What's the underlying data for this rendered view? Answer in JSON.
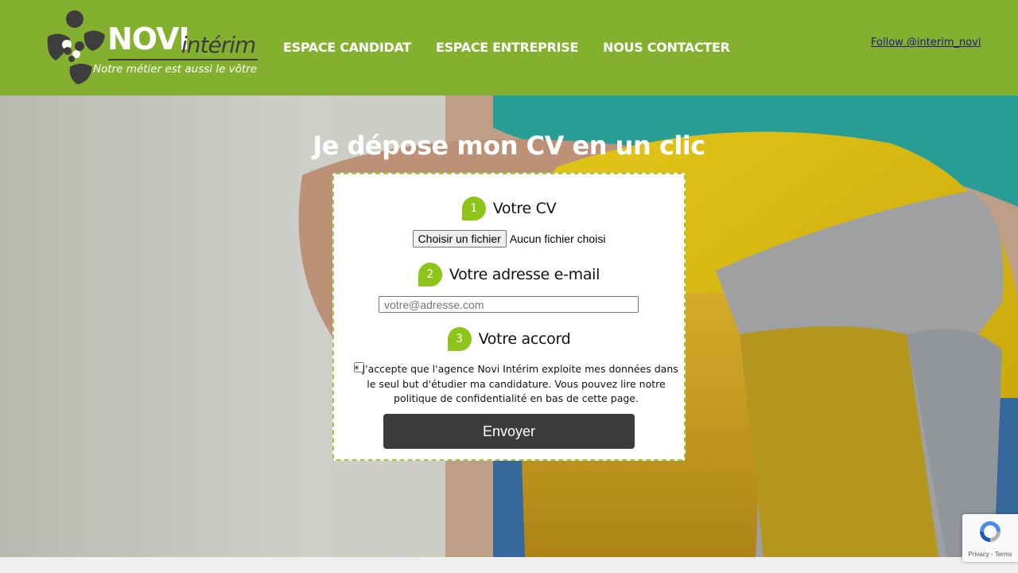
{
  "header": {
    "logo": {
      "brand": "NOVI",
      "brand_suffix": "intérim",
      "tagline": "Notre métier est aussi le vôtre"
    },
    "nav": [
      {
        "label": "ESPACE CANDIDAT"
      },
      {
        "label": "ESPACE ENTREPRISE"
      },
      {
        "label": "NOUS CONTACTER"
      }
    ],
    "follow_link": "Follow @interim_novi"
  },
  "hero": {
    "title": "Je dépose mon CV en un clic",
    "form": {
      "steps": [
        {
          "number": "1",
          "label": "Votre CV"
        },
        {
          "number": "2",
          "label": "Votre adresse e-mail"
        },
        {
          "number": "3",
          "label": "Votre accord"
        }
      ],
      "file_button": "Choisir un fichier",
      "file_status": "Aucun fichier choisi",
      "email_placeholder": "votre@adresse.com",
      "email_value": "",
      "consent_checked": false,
      "consent_text": "* J'accepte que l'agence Novi Intérim exploite mes données dans le seul but d'étudier ma candidature. Vous pouvez lire notre politique de confidentialité en bas de cette page.",
      "submit_label": "Envoyer"
    }
  },
  "recaptcha": {
    "links": "Privacy - Terms"
  },
  "colors": {
    "header_green": "#84b02f",
    "accent_green": "#8cc517",
    "button_dark": "#3c3c3c",
    "logo_dark": "#3d3d3d"
  }
}
